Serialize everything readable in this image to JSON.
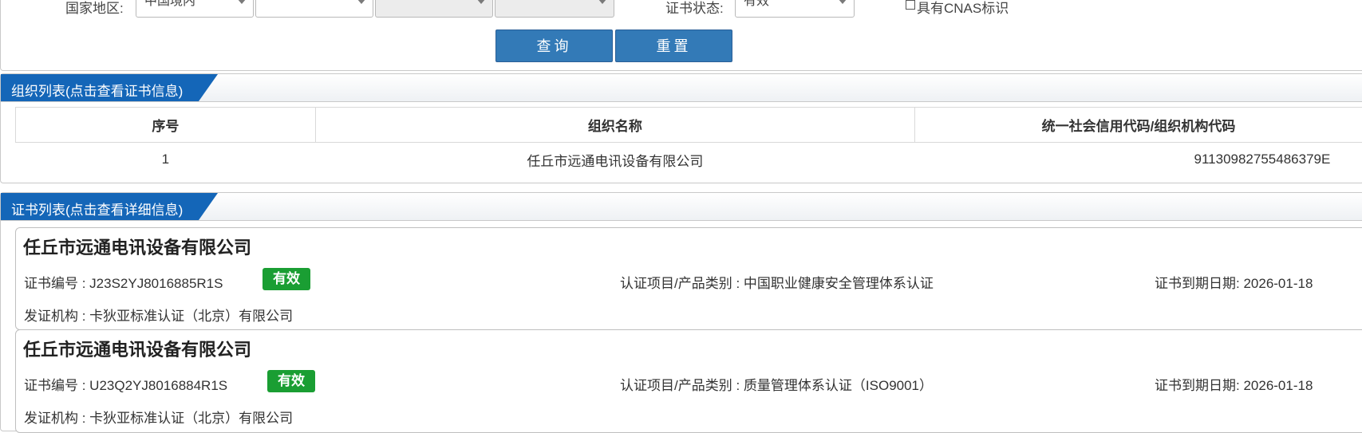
{
  "filters": {
    "region_label": "国家地区:",
    "region_value": "中国境内",
    "province_value": "",
    "city_value": "",
    "district_value": "",
    "status_label": "证书状态:",
    "status_value": "有效",
    "cnas_label": "具有CNAS标识",
    "query_button": "查询",
    "reset_button": "重置"
  },
  "org_section": {
    "title": "组织列表(点击查看证书信息)",
    "columns": [
      "序号",
      "组织名称",
      "统一社会信用代码/组织机构代码"
    ],
    "rows": [
      {
        "index": "1",
        "name": "任丘市远通电讯设备有限公司",
        "code": "91130982755486379E"
      }
    ]
  },
  "cert_section": {
    "title": "证书列表(点击查看详细信息)",
    "certificates": [
      {
        "org_name": "任丘市远通电讯设备有限公司",
        "cert_no_label": "证书编号 : ",
        "cert_no": "J23S2YJ8016885R1S",
        "status": "有效",
        "project_label": "认证项目/产品类别 : ",
        "project": "中国职业健康安全管理体系认证",
        "expiry_label": "证书到期日期: ",
        "expiry": "2026-01-18",
        "issuer_label": "发证机构 : ",
        "issuer": "卡狄亚标准认证（北京）有限公司"
      },
      {
        "org_name": "任丘市远通电讯设备有限公司",
        "cert_no_label": "证书编号 : ",
        "cert_no": "U23Q2YJ8016884R1S",
        "status": "有效",
        "project_label": "认证项目/产品类别 : ",
        "project": "质量管理体系认证（ISO9001）",
        "expiry_label": "证书到期日期: ",
        "expiry": "2026-01-18",
        "issuer_label": "发证机构 : ",
        "issuer": "卡狄亚标准认证（北京）有限公司"
      }
    ]
  },
  "colors": {
    "primary_button": "#337ab7",
    "tab_blue": "#1466b8",
    "valid_badge": "#1a9e33"
  }
}
